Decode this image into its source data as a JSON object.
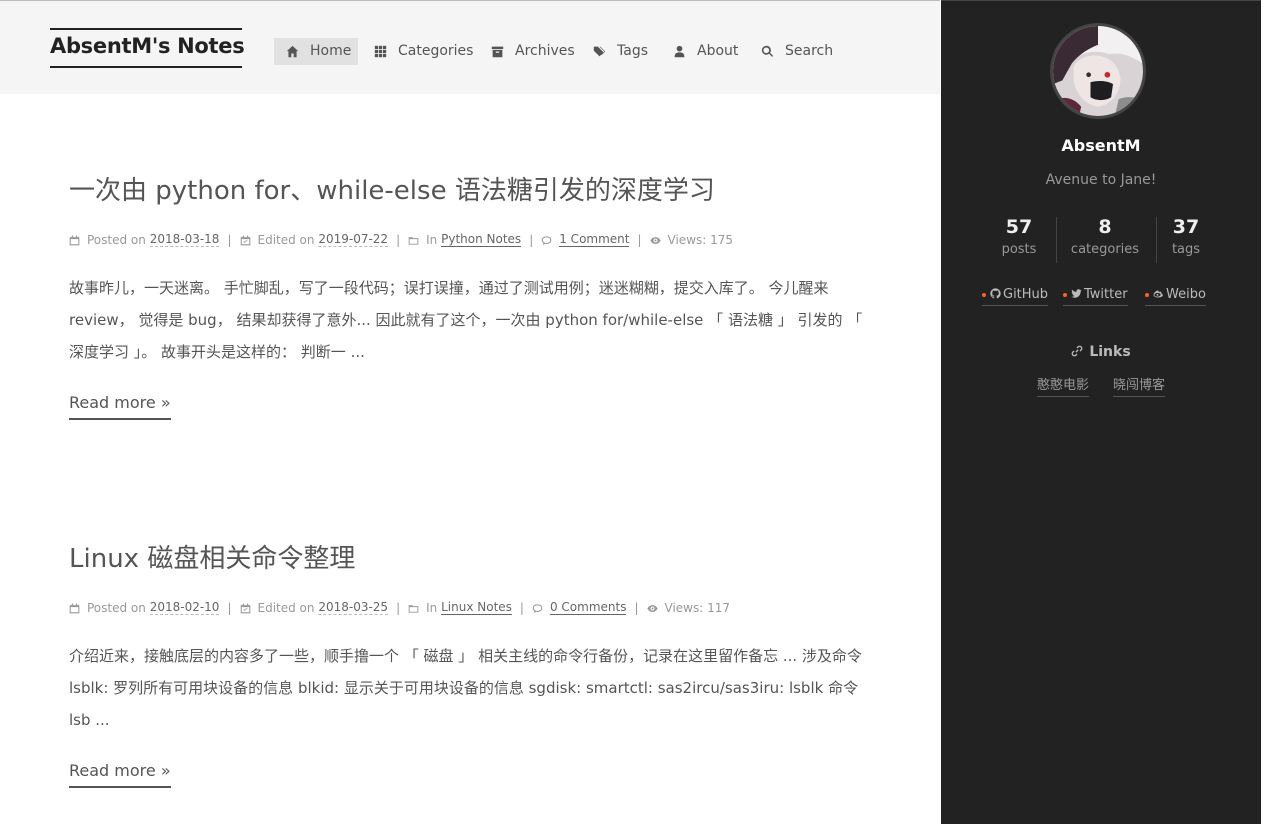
{
  "site": {
    "title": "AbsentM's Notes"
  },
  "menu": [
    {
      "label": "Home",
      "icon": "home-icon",
      "active": true
    },
    {
      "label": "Categories",
      "icon": "th-icon"
    },
    {
      "label": "Archives",
      "icon": "archive-icon"
    },
    {
      "label": "Tags",
      "icon": "tags-icon"
    },
    {
      "label": "About",
      "icon": "user-icon"
    },
    {
      "label": "Search",
      "icon": "search-icon"
    }
  ],
  "posts": [
    {
      "title": "一次由 python for、while-else 语法糖引发的深度学习",
      "posted_label": "Posted on",
      "posted": "2018-03-18",
      "edited_label": "Edited on",
      "edited": "2019-07-22",
      "in_label": "In",
      "category": "Python Notes",
      "comments": "1 Comment",
      "views_label": "Views:",
      "views": "175",
      "excerpt": "故事昨儿，一天迷离。 手忙脚乱，写了一段代码；误打误撞，通过了测试用例；迷迷糊糊，提交入库了。 今儿醒来 review， 觉得是 bug， 结果却获得了意外... 因此就有了这个，一次由 python for/while-else 「 语法糖 」 引发的 「 深度学习 」。 故事开头是这样的： 判断一 ...",
      "read_more": "Read more »"
    },
    {
      "title": "Linux 磁盘相关命令整理",
      "posted_label": "Posted on",
      "posted": "2018-02-10",
      "edited_label": "Edited on",
      "edited": "2018-03-25",
      "in_label": "In",
      "category": "Linux Notes",
      "comments": "0 Comments",
      "views_label": "Views:",
      "views": "117",
      "excerpt": "介绍近来，接触底层的内容多了一些，顺手撸一个 「 磁盘 」 相关主线的命令行备份，记录在这里留作备忘 ... 涉及命令 lsblk: 罗列所有可用块设备的信息 blkid: 显示关于可用块设备的信息 sgdisk: smartctl: sas2ircu/sas3iru: lsblk 命令 lsb ...",
      "read_more": "Read more »"
    }
  ],
  "sidebar": {
    "author": "AbsentM",
    "description": "Avenue to Jane!",
    "stats": [
      {
        "count": "57",
        "label": "posts"
      },
      {
        "count": "8",
        "label": "categories"
      },
      {
        "count": "37",
        "label": "tags"
      }
    ],
    "social": [
      {
        "label": "GitHub",
        "icon": "github-icon"
      },
      {
        "label": "Twitter",
        "icon": "twitter-icon"
      },
      {
        "label": "Weibo",
        "icon": "weibo-icon"
      }
    ],
    "links_title": "Links",
    "links": [
      "憨憨电影",
      "晓闯博客"
    ]
  },
  "colors": {
    "sidebar_bg": "#222222",
    "header_bg": "#f5f5f5",
    "active_menu_bg": "#e1e1e1",
    "social_dot": "#fc6423"
  }
}
